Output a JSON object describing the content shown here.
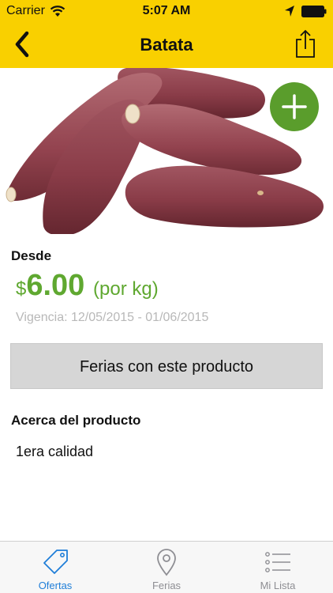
{
  "status_bar": {
    "carrier": "Carrier",
    "time": "5:07 AM"
  },
  "nav": {
    "title": "Batata",
    "back_icon": "chevron-left-icon",
    "share_icon": "share-icon"
  },
  "product": {
    "image": "sweet-potato-photo",
    "add_icon": "plus-icon",
    "desde_label": "Desde",
    "currency": "$",
    "price": "6.00",
    "unit": "(por kg)",
    "vigencia": "Vigencia: 12/05/2015 - 01/06/2015"
  },
  "ferias_button": {
    "label": "Ferias con este producto"
  },
  "about": {
    "title": "Acerca del producto",
    "text": "1era calidad"
  },
  "tabs": [
    {
      "label": "Ofertas",
      "icon": "tag-icon",
      "active": true
    },
    {
      "label": "Ferias",
      "icon": "map-pin-icon",
      "active": false
    },
    {
      "label": "Mi Lista",
      "icon": "list-icon",
      "active": false
    }
  ],
  "colors": {
    "nav_bg": "#f9d000",
    "price_green": "#5fa830",
    "add_button": "#5a9d2c",
    "active_tab": "#1f7ed8"
  }
}
